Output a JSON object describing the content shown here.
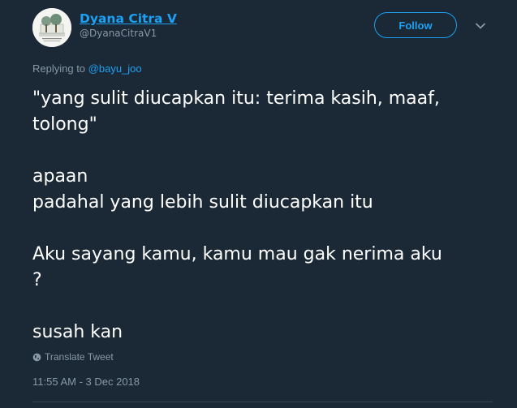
{
  "author": {
    "display_name": "Dyana Citra V",
    "username": "@DyanaCitraV1"
  },
  "follow_button": {
    "label": "Follow"
  },
  "reply": {
    "prefix": "Replying to ",
    "mention": "@bayu_joo"
  },
  "tweet": {
    "text": "\"yang sulit diucapkan itu: terima kasih, maaf,\ntolong\"\n\napaan\npadahal yang lebih sulit diucapkan itu\n\nAku sayang kamu, kamu mau gak nerima aku\n?\n\nsusah kan",
    "translate_label": "Translate Tweet",
    "timestamp": "11:55 AM - 3 Dec 2018"
  },
  "colors": {
    "background": "#1b2836",
    "accent": "#1da1f2",
    "muted": "#8899a6",
    "text": "#ffffff"
  },
  "icons": {
    "caret": "chevron-down-icon",
    "translate": "globe-icon"
  }
}
